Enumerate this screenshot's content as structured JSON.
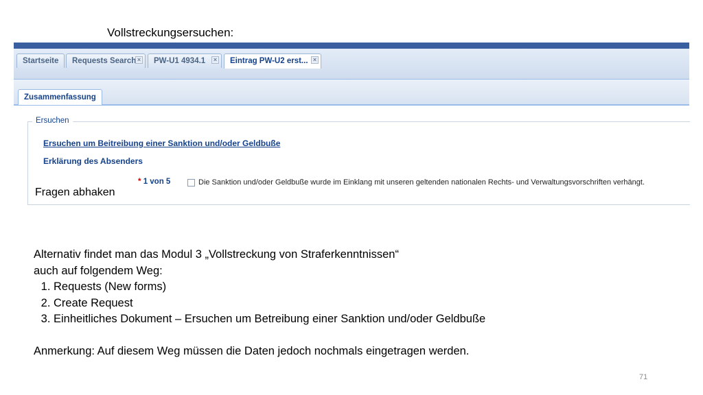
{
  "slide": {
    "title": "Vollstreckungsersuchen:",
    "overlay_label": "Fragen abhaken",
    "page_number": "71"
  },
  "app": {
    "tabs": [
      {
        "label": "Startseite",
        "closable": false
      },
      {
        "label": "Requests Search",
        "closable": true
      },
      {
        "label": "PW-U1 4934.1",
        "closable": true
      },
      {
        "label": "Eintrag PW-U2 erst...",
        "closable": true,
        "active": true
      }
    ],
    "subtab": "Zusammenfassung",
    "fieldset_legend": "Ersuchen",
    "link": "Ersuchen um Beitreibung einer Sanktion und/oder Geldbuße",
    "section_heading": "Erklärung des Absenders",
    "counter_required": "*",
    "counter": "1 von 5",
    "checkbox_label": "Die Sanktion und/oder Geldbuße wurde im Einklang mit unseren geltenden nationalen Rechts- und Verwaltungsvorschriften verhängt.",
    "checkbox_checked": false
  },
  "notes": {
    "intro_line1": "Alternativ findet man das Modul 3 „Vollstreckung von Straferkenntnissen“",
    "intro_line2": "auch auf folgendem Weg:",
    "steps": [
      "Requests (New forms)",
      "Create Request",
      "Einheitliches Dokument – Ersuchen um Betreibung einer Sanktion und/oder Geldbuße"
    ],
    "remark": "Anmerkung: Auf diesem Weg müssen die Daten jedoch nochmals eingetragen werden."
  },
  "colors": {
    "app_topbar": "#3a5fa0",
    "tab_text": "#15428b",
    "required_marker": "#d40000"
  }
}
